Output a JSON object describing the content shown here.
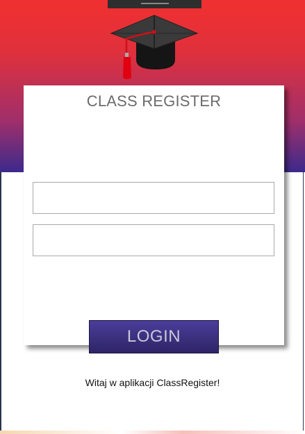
{
  "app": {
    "title": "CLASS REGISTER",
    "logo_icon": "graduation-cap-icon"
  },
  "form": {
    "login_value": "",
    "password_value": "",
    "login_button_label": "LOGIN"
  },
  "footer": {
    "welcome_text": "Witaj w aplikacji ClassRegister!"
  },
  "colors": {
    "header_gradient_top": "#f03030",
    "header_gradient_bottom": "#3c2a8c",
    "button_top": "#4b3d9a",
    "button_bottom": "#2e2466",
    "title_text": "#6b6b6b"
  }
}
